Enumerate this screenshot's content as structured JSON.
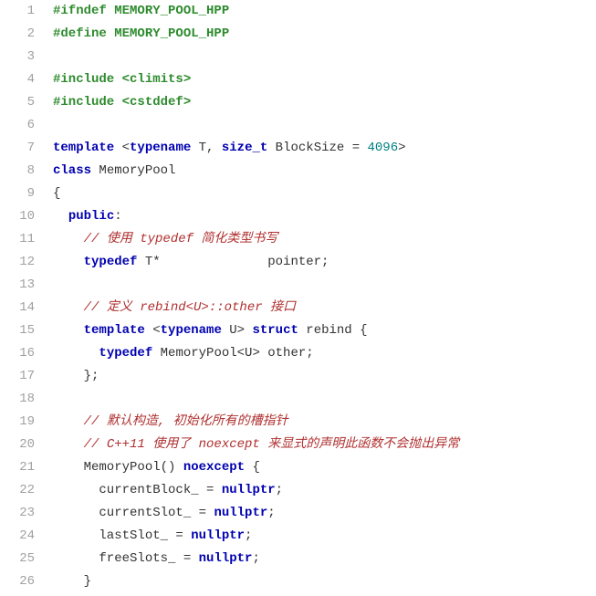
{
  "lines": [
    {
      "n": "1",
      "c": "<span class=\"preproc\">#ifndef MEMORY_POOL_HPP</span>"
    },
    {
      "n": "2",
      "c": "<span class=\"preproc\">#define MEMORY_POOL_HPP</span>"
    },
    {
      "n": "3",
      "c": ""
    },
    {
      "n": "4",
      "c": "<span class=\"preproc\">#include &lt;climits&gt;</span>"
    },
    {
      "n": "5",
      "c": "<span class=\"preproc\">#include &lt;cstddef&gt;</span>"
    },
    {
      "n": "6",
      "c": ""
    },
    {
      "n": "7",
      "c": "<span class=\"keyword\">template</span> &lt;<span class=\"keyword\">typename</span> T, <span class=\"type\">size_t</span> BlockSize = <span class=\"number\">4096</span>&gt;"
    },
    {
      "n": "8",
      "c": "<span class=\"keyword\">class</span> <span class=\"ident\">MemoryPool</span>"
    },
    {
      "n": "9",
      "c": "{"
    },
    {
      "n": "10",
      "c": "  <span class=\"keyword\">public</span>:"
    },
    {
      "n": "11",
      "c": "    <span class=\"comment-it\">// 使用 typedef 简化类型书写</span>"
    },
    {
      "n": "12",
      "c": "    <span class=\"keyword\">typedef</span> T*              pointer;"
    },
    {
      "n": "13",
      "c": ""
    },
    {
      "n": "14",
      "c": "    <span class=\"comment-it\">// 定义 rebind&lt;U&gt;::other 接口</span>"
    },
    {
      "n": "15",
      "c": "    <span class=\"keyword\">template</span> &lt;<span class=\"keyword\">typename</span> U&gt; <span class=\"keyword\">struct</span> <span class=\"ident\">rebind</span> {"
    },
    {
      "n": "16",
      "c": "      <span class=\"keyword\">typedef</span> MemoryPool&lt;U&gt; other;"
    },
    {
      "n": "17",
      "c": "    };"
    },
    {
      "n": "18",
      "c": ""
    },
    {
      "n": "19",
      "c": "    <span class=\"comment-it\">// 默认构造, 初始化所有的槽指针</span>"
    },
    {
      "n": "20",
      "c": "    <span class=\"comment-it\">// C++11 使用了 noexcept 来显式的声明此函数不会抛出异常</span>"
    },
    {
      "n": "21",
      "c": "    MemoryPool() <span class=\"keyword\">noexcept</span> {"
    },
    {
      "n": "22",
      "c": "      currentBlock_ = <span class=\"keyword\">nullptr</span>;"
    },
    {
      "n": "23",
      "c": "      currentSlot_ = <span class=\"keyword\">nullptr</span>;"
    },
    {
      "n": "24",
      "c": "      lastSlot_ = <span class=\"keyword\">nullptr</span>;"
    },
    {
      "n": "25",
      "c": "      freeSlots_ = <span class=\"keyword\">nullptr</span>;"
    },
    {
      "n": "26",
      "c": "    }"
    }
  ]
}
